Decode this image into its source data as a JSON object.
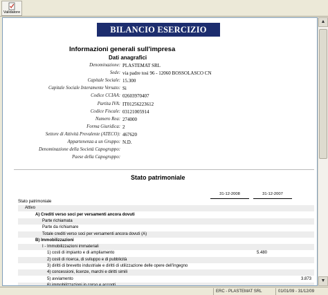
{
  "toolbar": {
    "validator_label": "Validatore"
  },
  "document": {
    "banner": "BILANCIO ESERCIZIO",
    "info_title": "Informazioni generali sull'impresa",
    "info_subtitle": "Dati anagrafici",
    "fields": [
      {
        "label": "Denominazione:",
        "value": "PLASTEMAT SRL"
      },
      {
        "label": "Sede:",
        "value": "via padre tosi 96 - 12060 BOSSOLASCO CN"
      },
      {
        "label": "Capitale Sociale:",
        "value": "15.300"
      },
      {
        "label": "Capitale Sociale Interamente Versato:",
        "value": "Si"
      },
      {
        "label": "Codice CCIAA:",
        "value": "02603970407"
      },
      {
        "label": "Partita IVA:",
        "value": "IT01256223612"
      },
      {
        "label": "Codice Fiscale:",
        "value": "03121005914"
      },
      {
        "label": "Numero Rea:",
        "value": "274000"
      },
      {
        "label": "Forma Giuridica:",
        "value": "2"
      },
      {
        "label": "Settore di Attività Prevalente (ATECO):",
        "value": "467620"
      },
      {
        "label": "Appartenenza a un Gruppo:",
        "value": "N.D."
      },
      {
        "label": "Denominazione della Società Capogruppo:",
        "value": ""
      },
      {
        "label": "Paese della Capogruppo:",
        "value": ""
      }
    ],
    "sp_title": "Stato patrimoniale",
    "columns": [
      "31-12-2008",
      "31-12-2007"
    ],
    "rows": [
      {
        "label": "Stato patrimoniale",
        "v1": "",
        "v2": "",
        "indent": 0,
        "bold": false,
        "shade": false
      },
      {
        "label": "Attivo",
        "v1": "",
        "v2": "",
        "indent": 1,
        "bold": false,
        "shade": true
      },
      {
        "label": "A) Crediti verso soci per versamenti ancora dovuti",
        "v1": "",
        "v2": "",
        "indent": 2,
        "bold": true,
        "shade": false
      },
      {
        "label": "Parte richiamata",
        "v1": "",
        "v2": "",
        "indent": 3,
        "bold": false,
        "shade": true
      },
      {
        "label": "Parte da richiamare",
        "v1": "",
        "v2": "",
        "indent": 3,
        "bold": false,
        "shade": false
      },
      {
        "label": "Totale crediti verso soci per versamenti ancora dovuti (A)",
        "v1": "",
        "v2": "",
        "indent": 3,
        "bold": false,
        "shade": true
      },
      {
        "label": "B) Immobilizzazioni",
        "v1": "",
        "v2": "",
        "indent": 2,
        "bold": true,
        "shade": false
      },
      {
        "label": "I - Immobilizzazioni immateriali",
        "v1": "",
        "v2": "",
        "indent": 3,
        "bold": false,
        "shade": true
      },
      {
        "label": "1) costi di impianto e di ampliamento",
        "v1": "5.480",
        "v2": "",
        "indent": 4,
        "bold": false,
        "shade": false
      },
      {
        "label": "2) costi di ricerca, di sviluppo e di pubblicità",
        "v1": "",
        "v2": "",
        "indent": 4,
        "bold": false,
        "shade": true
      },
      {
        "label": "3) diritti di brevetto industriale e diritti di utilizzazione delle opere dell'ingegno",
        "v1": "",
        "v2": "",
        "indent": 4,
        "bold": false,
        "shade": false
      },
      {
        "label": "4) concessioni, licenze, marchi e diritti simili",
        "v1": "",
        "v2": "",
        "indent": 4,
        "bold": false,
        "shade": true
      },
      {
        "label": "5) avviamento",
        "v1": "",
        "v2": "3.873",
        "indent": 4,
        "bold": false,
        "shade": false
      },
      {
        "label": "6) immobilizzazioni in corso e acconti",
        "v1": "",
        "v2": "",
        "indent": 4,
        "bold": false,
        "shade": true
      },
      {
        "label": "7) altre",
        "v1": "",
        "v2": "",
        "indent": 4,
        "bold": false,
        "shade": false
      }
    ]
  },
  "statusbar": {
    "app_info": "ERC - PLASTEMAT SRL",
    "period": "01/01/09 - 31/12/09"
  }
}
